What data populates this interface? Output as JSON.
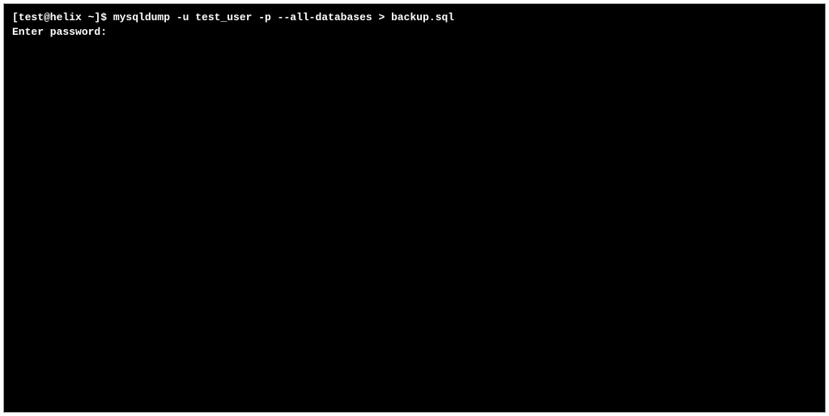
{
  "terminal": {
    "prompt": "[test@helix ~]$ ",
    "command": "mysqldump -u test_user -p --all-databases > backup.sql",
    "password_prompt": "Enter password:"
  }
}
